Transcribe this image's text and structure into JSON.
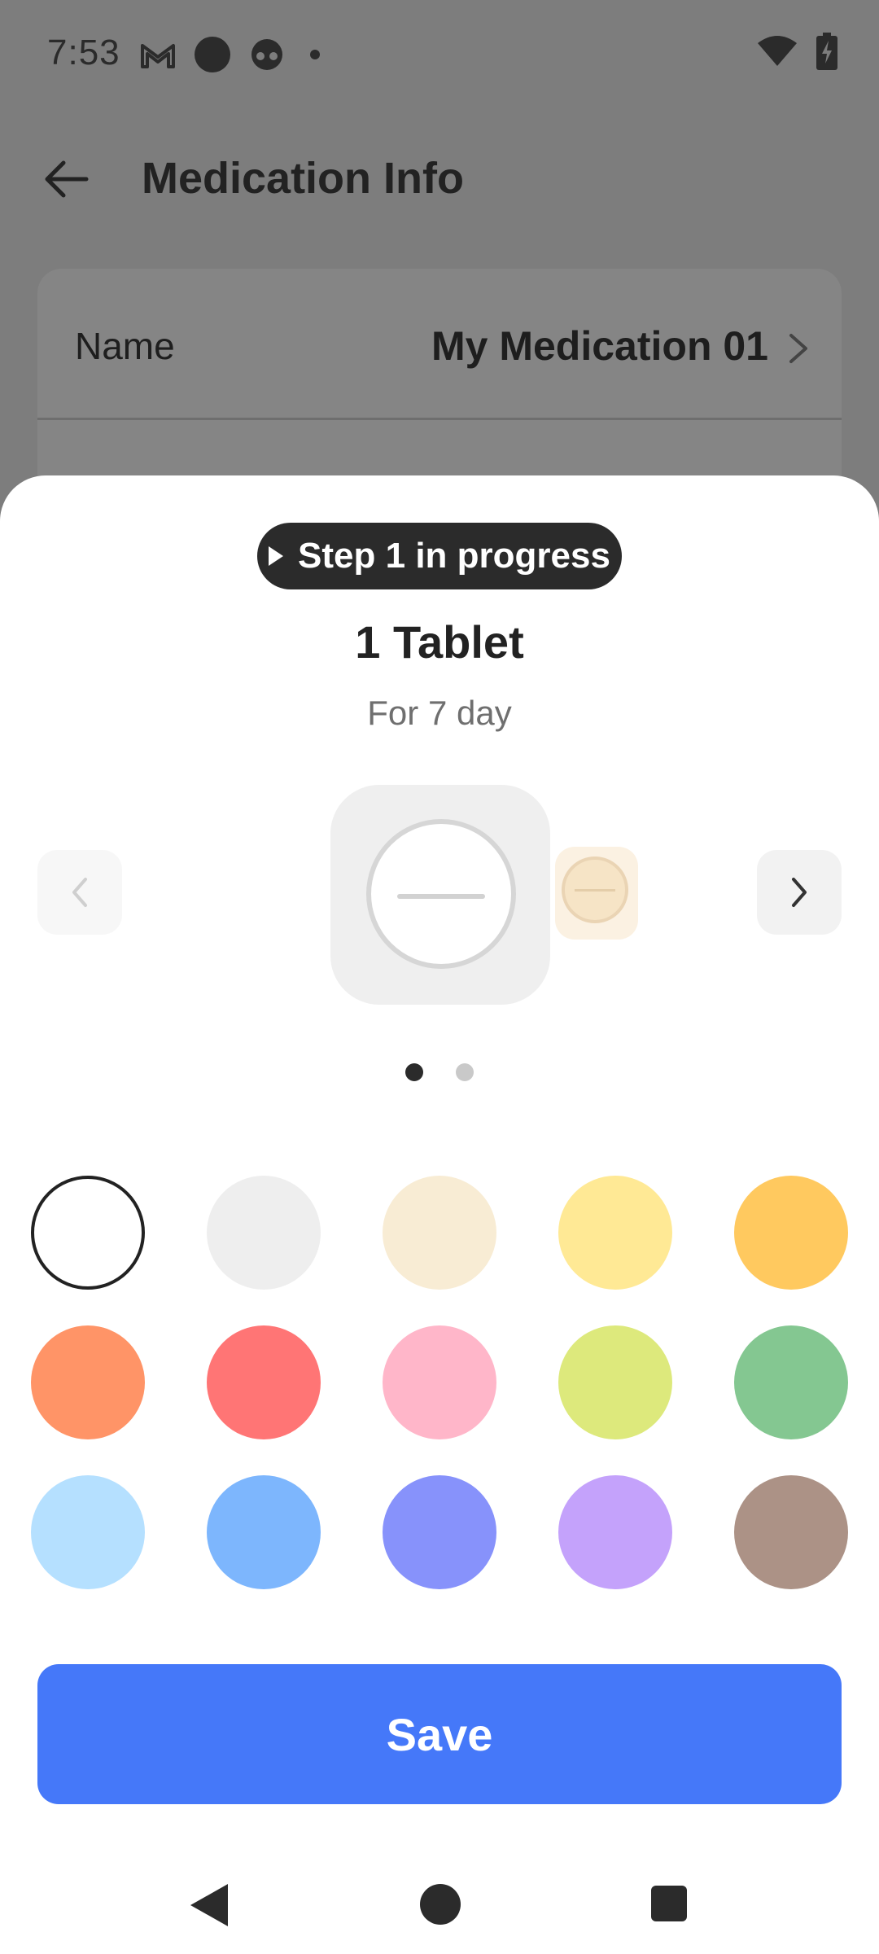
{
  "status_bar": {
    "time": "7:53",
    "left_icons": [
      "gmail-icon",
      "circle-notification-icon",
      "game-controller-icon",
      "dot-icon"
    ],
    "right_icons": [
      "wifi-icon",
      "battery-charging-icon"
    ]
  },
  "app_bar": {
    "title": "Medication Info",
    "back_icon": "arrow-left-icon"
  },
  "info_card": {
    "rows": [
      {
        "label": "Name",
        "value": "My Medication 01",
        "icon": "chevron-right-icon"
      }
    ]
  },
  "sheet": {
    "step_badge": "Step 1 in progress",
    "dose_title": "1 Tablet",
    "dose_subtitle": "For 7 day",
    "carousel": {
      "prev_icon": "chevron-left-icon",
      "next_icon": "chevron-right-icon",
      "page_count": 2,
      "active_page": 1
    },
    "palette": [
      {
        "color": "#ffffff",
        "selected": true
      },
      {
        "color": "#eeeeee",
        "selected": false
      },
      {
        "color": "#f8ecd4",
        "selected": false
      },
      {
        "color": "#ffe995",
        "selected": false
      },
      {
        "color": "#ffc95f",
        "selected": false
      },
      {
        "color": "#ff9467",
        "selected": false
      },
      {
        "color": "#ff7575",
        "selected": false
      },
      {
        "color": "#ffb6c9",
        "selected": false
      },
      {
        "color": "#dde97c",
        "selected": false
      },
      {
        "color": "#84c791",
        "selected": false
      },
      {
        "color": "#b5e0ff",
        "selected": false
      },
      {
        "color": "#7db6fd",
        "selected": false
      },
      {
        "color": "#8792fb",
        "selected": false
      },
      {
        "color": "#c4a2fb",
        "selected": false
      },
      {
        "color": "#ac9286",
        "selected": false
      }
    ],
    "save_label": "Save",
    "accent_color": "#4578f9"
  },
  "nav_bar": {
    "icons": [
      "nav-back-icon",
      "nav-home-icon",
      "nav-recents-icon"
    ]
  }
}
